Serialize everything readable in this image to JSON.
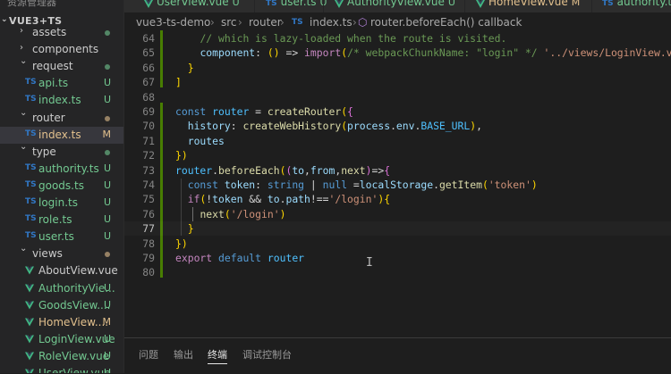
{
  "sidebar": {
    "header": "资源管理器",
    "root": "VUE3+TS",
    "items": [
      {
        "label": "assets",
        "kind": "folder",
        "badge": "",
        "dot": "green"
      },
      {
        "label": "components",
        "kind": "folder",
        "badge": "",
        "dot": ""
      },
      {
        "label": "request",
        "kind": "folder",
        "badge": "",
        "dot": "green"
      },
      {
        "label": "api.ts",
        "kind": "ts",
        "badge": "U",
        "dot": ""
      },
      {
        "label": "index.ts",
        "kind": "ts",
        "badge": "U",
        "dot": ""
      },
      {
        "label": "router",
        "kind": "folder",
        "badge": "",
        "dot": "amber"
      },
      {
        "label": "index.ts",
        "kind": "ts",
        "badge": "M",
        "dot": ""
      },
      {
        "label": "type",
        "kind": "folder",
        "badge": "",
        "dot": "green"
      },
      {
        "label": "authority.ts",
        "kind": "ts",
        "badge": "U",
        "dot": ""
      },
      {
        "label": "goods.ts",
        "kind": "ts",
        "badge": "U",
        "dot": ""
      },
      {
        "label": "login.ts",
        "kind": "ts",
        "badge": "U",
        "dot": ""
      },
      {
        "label": "role.ts",
        "kind": "ts",
        "badge": "U",
        "dot": ""
      },
      {
        "label": "user.ts",
        "kind": "ts",
        "badge": "U",
        "dot": ""
      },
      {
        "label": "views",
        "kind": "folder",
        "badge": "",
        "dot": "amber"
      },
      {
        "label": "AboutView.vue",
        "kind": "vue",
        "badge": "",
        "dot": ""
      },
      {
        "label": "AuthorityVie...",
        "kind": "vue",
        "badge": "U",
        "dot": ""
      },
      {
        "label": "GoodsView....",
        "kind": "vue",
        "badge": "U",
        "dot": ""
      },
      {
        "label": "HomeView....",
        "kind": "vue",
        "badge": "M",
        "dot": ""
      },
      {
        "label": "LoginView.vue",
        "kind": "vue",
        "badge": "U",
        "dot": ""
      },
      {
        "label": "RoleView.vue",
        "kind": "vue",
        "badge": "U",
        "dot": ""
      },
      {
        "label": "UserView.vue",
        "kind": "vue",
        "badge": "U",
        "dot": ""
      }
    ]
  },
  "tabs": [
    {
      "label": "UserView.vue",
      "status": "U",
      "kind": "vue"
    },
    {
      "label": "user.ts",
      "status": "U",
      "kind": "ts"
    },
    {
      "label": "AuthorityView.vue",
      "status": "U",
      "kind": "vue"
    },
    {
      "label": "HomeView.vue",
      "status": "M",
      "kind": "vue"
    },
    {
      "label": "authority.ts",
      "status": "U",
      "kind": "ts"
    }
  ],
  "breadcrumb": {
    "project": "vue3-ts-demo",
    "folder1": "src",
    "folder2": "router",
    "file_icon": "TS",
    "file": "index.ts",
    "symbol": "router.beforeEach() callback"
  },
  "editor": {
    "lines": [
      {
        "n": "64",
        "text": "    // which is lazy-loaded when the route is visited."
      },
      {
        "n": "65",
        "text": "    component: () => import(/* webpackChunkName: \"login\" */ '../views/LoginView.vue')"
      },
      {
        "n": "66",
        "text": "  }"
      },
      {
        "n": "67",
        "text": "]"
      },
      {
        "n": "68",
        "text": ""
      },
      {
        "n": "69",
        "text": "const router = createRouter({"
      },
      {
        "n": "70",
        "text": "  history: createWebHistory(process.env.BASE_URL),"
      },
      {
        "n": "71",
        "text": "  routes"
      },
      {
        "n": "72",
        "text": "})"
      },
      {
        "n": "73",
        "text": "router.beforeEach((to,from,next)=>{"
      },
      {
        "n": "74",
        "text": "  const token: string | null =localStorage.getItem('token')"
      },
      {
        "n": "75",
        "text": "  if(!token && to.path!=='/login'){"
      },
      {
        "n": "76",
        "text": "    next('/login')"
      },
      {
        "n": "77",
        "text": "  }"
      },
      {
        "n": "78",
        "text": "})"
      },
      {
        "n": "79",
        "text": "export default router"
      },
      {
        "n": "80",
        "text": ""
      }
    ]
  },
  "panel": {
    "tabs": [
      "问题",
      "输出",
      "终端",
      "调试控制台"
    ],
    "active": "终端"
  },
  "colors": {
    "editor_bg": "#1e1e1e",
    "sidebar_bg": "#252526",
    "untracked": "#73c991",
    "modified": "#e2c08d",
    "ts_blue": "#3178c6",
    "vue_green": "#41b883"
  },
  "icons": [
    "chevron-right-icon",
    "chevron-down-icon",
    "ts-file-icon",
    "vue-file-icon",
    "symbol-method-icon",
    "text-cursor-icon"
  ]
}
